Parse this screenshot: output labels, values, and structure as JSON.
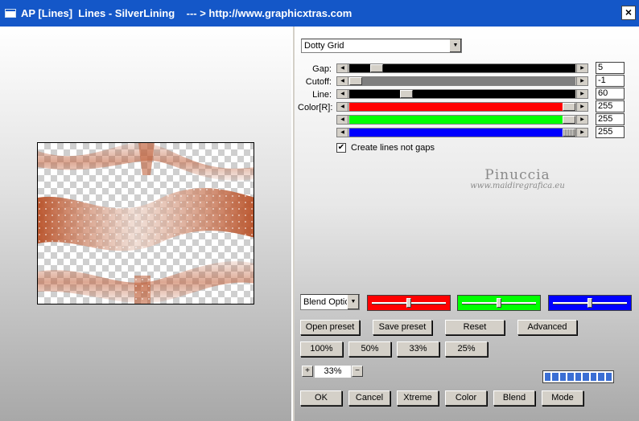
{
  "window": {
    "title": "AP [Lines]  Lines - SilverLining    --- > http://www.graphicxtras.com",
    "close_glyph": "×"
  },
  "preset_select": {
    "value": "Dotty Grid"
  },
  "params": [
    {
      "label": "Gap:",
      "value": "5"
    },
    {
      "label": "Cutoff:",
      "value": "-1"
    },
    {
      "label": "Line:",
      "value": "60"
    },
    {
      "label": "Color[R]:",
      "value": "255"
    },
    {
      "label": "",
      "value": "255"
    },
    {
      "label": "",
      "value": "255"
    }
  ],
  "checkbox": {
    "label": "Create lines not gaps",
    "checked": true
  },
  "watermark": {
    "name": "Pinuccia",
    "site": "www.maidiregrafica.eu"
  },
  "blend_select": {
    "value": "Blend Optio"
  },
  "color_sliders": [
    {
      "color": "#ff0000",
      "level": 0.5
    },
    {
      "color": "#00ff00",
      "level": 0.5
    },
    {
      "color": "#0000ff",
      "level": 0.5
    }
  ],
  "buttons_row1": [
    "Open preset",
    "Save preset",
    "Reset",
    "Advanced"
  ],
  "zoom_buttons": [
    "100%",
    "50%",
    "33%",
    "25%"
  ],
  "zoom": {
    "plus": "+",
    "minus": "−",
    "value": "33%"
  },
  "bottom_buttons": [
    "OK",
    "Cancel",
    "Xtreme",
    "Color",
    "Blend",
    "Mode"
  ],
  "colors": {
    "titlebar": "#1457c8",
    "line_brown": "#c0603a"
  }
}
